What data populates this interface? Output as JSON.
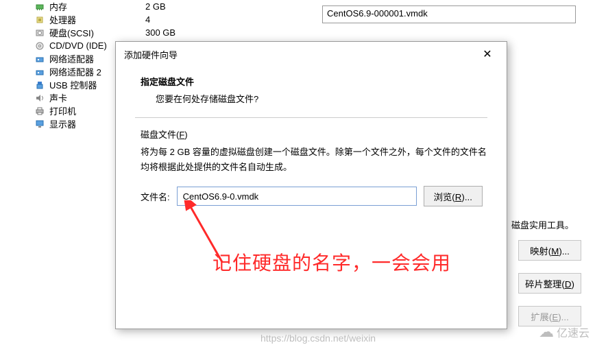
{
  "devices": {
    "memory": {
      "label": "内存",
      "value": "2 GB"
    },
    "cpu": {
      "label": "处理器",
      "value": "4"
    },
    "disk": {
      "label": "硬盘(SCSI)",
      "value": "300 GB"
    },
    "cddvd": {
      "label": "CD/DVD (IDE)",
      "value": ""
    },
    "net1": {
      "label": "网络适配器",
      "value": ""
    },
    "net2": {
      "label": "网络适配器 2",
      "value": ""
    },
    "usb": {
      "label": "USB 控制器",
      "value": ""
    },
    "sound": {
      "label": "声卡",
      "value": ""
    },
    "printer": {
      "label": "打印机",
      "value": ""
    },
    "display": {
      "label": "显示器",
      "value": ""
    }
  },
  "right_field_value": "CentOS6.9-000001.vmdk",
  "dialog": {
    "title": "添加硬件向导",
    "heading": "指定磁盘文件",
    "sub": "您要在何处存储磁盘文件?",
    "section_label": "磁盘文件(F)",
    "desc": "将为每 2 GB 容量的虚拟磁盘创建一个磁盘文件。除第一个文件之外，每个文件的文件名均将根据此处提供的文件名自动生成。",
    "file_label": "文件名:",
    "file_value": "CentOS6.9-0.vmdk",
    "browse": "浏览(R)..."
  },
  "utility_text": "磁盘实用工具。",
  "side_buttons": {
    "map": "映射(M)...",
    "defrag": "碎片整理(D)",
    "expand": "扩展(E)..."
  },
  "annotation": "记住硬盘的名字，一会会用",
  "watermark_url": "https://blog.csdn.net/weixin",
  "watermark_logo": "亿速云",
  "icons": {
    "memory": "memory-icon",
    "cpu": "cpu-icon",
    "disk": "disk-icon",
    "cddvd": "cddvd-icon",
    "net": "network-icon",
    "usb": "usb-icon",
    "sound": "sound-icon",
    "printer": "printer-icon",
    "display": "display-icon"
  }
}
